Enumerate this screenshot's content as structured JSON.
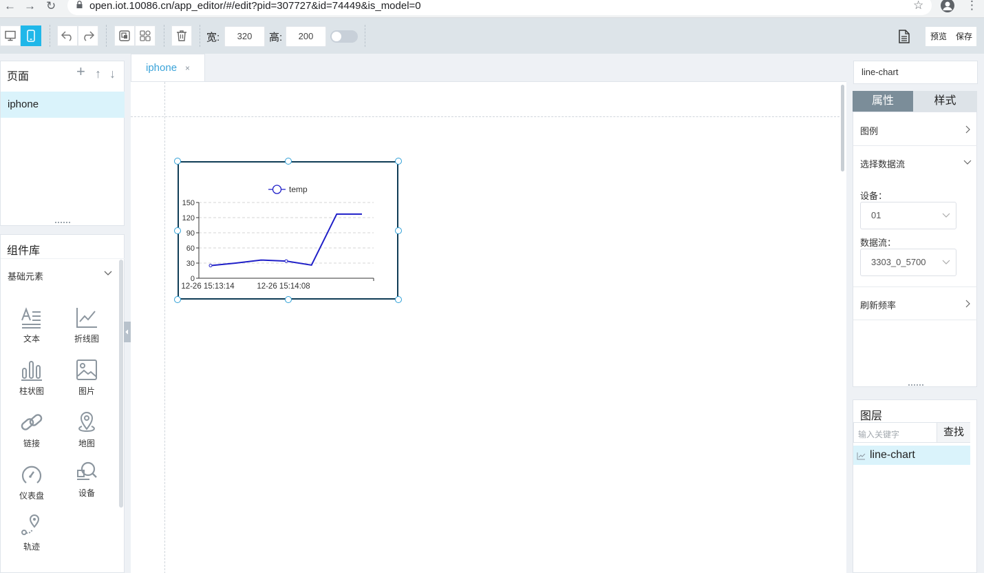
{
  "browser": {
    "url": "open.iot.10086.cn/app_editor/#/edit?pid=307727&id=74449&is_model=0",
    "back_glyph": "←",
    "forward_glyph": "→",
    "reload_glyph": "↻",
    "star_glyph": "☆",
    "menu_glyph": "⋮"
  },
  "toolbar": {
    "width_label": "宽:",
    "width_value": "320",
    "height_label": "高:",
    "height_value": "200",
    "preview_label": "预览",
    "save_label": "保存",
    "icons": [
      "desktop-icon",
      "mobile-icon",
      "undo-icon",
      "redo-icon",
      "copy-icon",
      "group-icon",
      "delete-icon",
      "document-icon"
    ],
    "accent_color": "#1fb7e9"
  },
  "pages": {
    "title": "页面",
    "add_glyph": "+",
    "up_glyph": "↑",
    "down_glyph": "↓",
    "items": [
      {
        "label": "iphone",
        "selected": true
      }
    ]
  },
  "library": {
    "title": "组件库",
    "section": "基础元素",
    "components": [
      {
        "label": "文本",
        "icon": "text-icon"
      },
      {
        "label": "折线图",
        "icon": "line-chart-icon"
      },
      {
        "label": "柱状图",
        "icon": "bar-chart-icon"
      },
      {
        "label": "图片",
        "icon": "image-icon"
      },
      {
        "label": "链接",
        "icon": "link-icon"
      },
      {
        "label": "地图",
        "icon": "map-pin-icon"
      },
      {
        "label": "仪表盘",
        "icon": "gauge-icon"
      },
      {
        "label": "设备",
        "icon": "device-icon"
      },
      {
        "label": "轨迹",
        "icon": "track-icon"
      }
    ]
  },
  "editor": {
    "tab": {
      "label": "iphone",
      "close_glyph": "×"
    }
  },
  "chart_data": {
    "type": "line",
    "x": [
      "12-26 15:13:14",
      "",
      "",
      "12-26 15:14:08",
      "",
      "",
      ""
    ],
    "xtick_labels": [
      "12-26 15:13:14",
      "12-26 15:14:08"
    ],
    "series": [
      {
        "name": "temp",
        "values": [
          25,
          30,
          36,
          34,
          26,
          127,
          127
        ],
        "color": "#1e1ec8"
      }
    ],
    "yticks": [
      0,
      30,
      60,
      90,
      120,
      150
    ],
    "ylim": [
      0,
      150
    ],
    "grid": true,
    "legend": "top-center"
  },
  "properties": {
    "component_name": "line-chart",
    "tabs": [
      {
        "label": "属性",
        "active": true
      },
      {
        "label": "样式",
        "active": false
      }
    ],
    "legend_row": "图例",
    "datastream_row": "选择数据流",
    "device_label": "设备：",
    "device_value": "01",
    "stream_label": "数据流：",
    "stream_value": "3303_0_5700",
    "refresh_row": "刷新频率"
  },
  "layers": {
    "title": "图层",
    "search_placeholder": "输入关键字",
    "search_button": "查找",
    "items": [
      {
        "label": "line-chart",
        "icon": "line-chart-icon"
      }
    ]
  }
}
